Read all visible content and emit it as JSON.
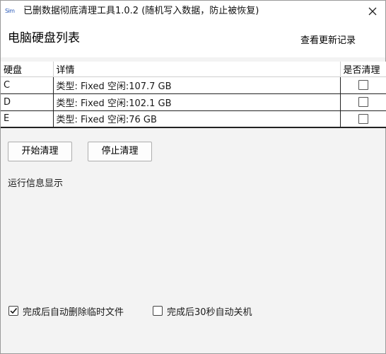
{
  "window": {
    "app_icon_text": "Sim",
    "title": "已删数据彻底清理工具1.0.2 (随机写入数据，防止被恢复)"
  },
  "header": {
    "title": "电脑硬盘列表",
    "update_link": "查看更新记录"
  },
  "table": {
    "columns": [
      "硬盘",
      "详情",
      "是否清理"
    ],
    "rows": [
      {
        "disk": "C",
        "detail": "类型: Fixed 空闲:107.7 GB",
        "checked": false
      },
      {
        "disk": "D",
        "detail": "类型: Fixed 空闲:102.1 GB",
        "checked": false
      },
      {
        "disk": "E",
        "detail": "类型: Fixed 空闲:76 GB",
        "checked": false
      }
    ]
  },
  "buttons": {
    "start": "开始清理",
    "stop": "停止清理"
  },
  "log": {
    "label": "运行信息显示"
  },
  "options": {
    "delete_temp": {
      "label": "完成后自动删除临时文件",
      "checked": true
    },
    "shutdown": {
      "label": "完成后30秒自动关机",
      "checked": false
    }
  }
}
